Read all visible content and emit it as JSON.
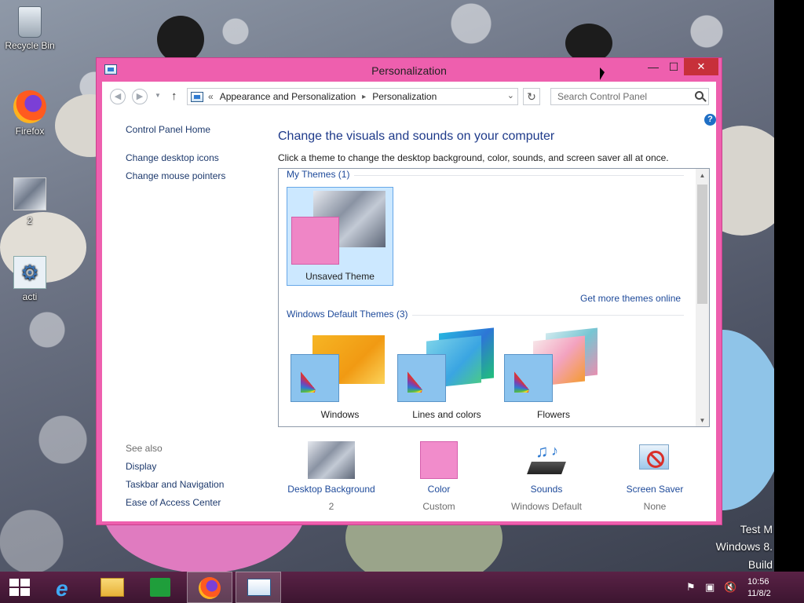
{
  "desktop": {
    "icons": [
      {
        "label": "Recycle Bin",
        "icon": "recycle-bin-icon"
      },
      {
        "label": "Firefox",
        "icon": "firefox-icon"
      },
      {
        "label": "2",
        "icon": "image-thumbnail-icon"
      },
      {
        "label": "acti",
        "icon": "settings-shortcut-icon"
      }
    ],
    "watermark": {
      "line1": "Test M",
      "line2": "Windows 8.",
      "line3": "Build"
    }
  },
  "window": {
    "title": "Personalization",
    "controls": {
      "minimize": "—",
      "maximize": "☐",
      "close": "✕"
    }
  },
  "address_bar": {
    "chevron": "«",
    "crumbs": [
      "Appearance and Personalization",
      "Personalization"
    ],
    "separator": "▸",
    "search_placeholder": "Search Control Panel"
  },
  "left_panel": {
    "links": [
      "Control Panel Home",
      "Change desktop icons",
      "Change mouse pointers"
    ],
    "see_also_label": "See also",
    "see_also": [
      "Display",
      "Taskbar and Navigation",
      "Ease of Access Center"
    ]
  },
  "main": {
    "heading": "Change the visuals and sounds on your computer",
    "subheading": "Click a theme to change the desktop background, color, sounds, and screen saver all at once.",
    "my_themes_title": "My Themes (1)",
    "my_themes": [
      {
        "name": "Unsaved Theme"
      }
    ],
    "get_more_link": "Get more themes online",
    "default_themes_title": "Windows Default Themes (3)",
    "default_themes": [
      {
        "name": "Windows"
      },
      {
        "name": "Lines and colors"
      },
      {
        "name": "Flowers"
      }
    ]
  },
  "bottom": {
    "items": [
      {
        "label": "Desktop Background",
        "value": "2",
        "icon": "desktop-background-icon"
      },
      {
        "label": "Color",
        "value": "Custom",
        "icon": "color-swatch-icon"
      },
      {
        "label": "Sounds",
        "value": "Windows Default",
        "icon": "sounds-icon"
      },
      {
        "label": "Screen Saver",
        "value": "None",
        "icon": "screen-saver-icon"
      }
    ]
  },
  "taskbar": {
    "clock_time": "10:56",
    "clock_date": "11/8/2",
    "colors": {
      "accent": "#ee5fae",
      "taskbar": "#4a1b3b"
    }
  }
}
